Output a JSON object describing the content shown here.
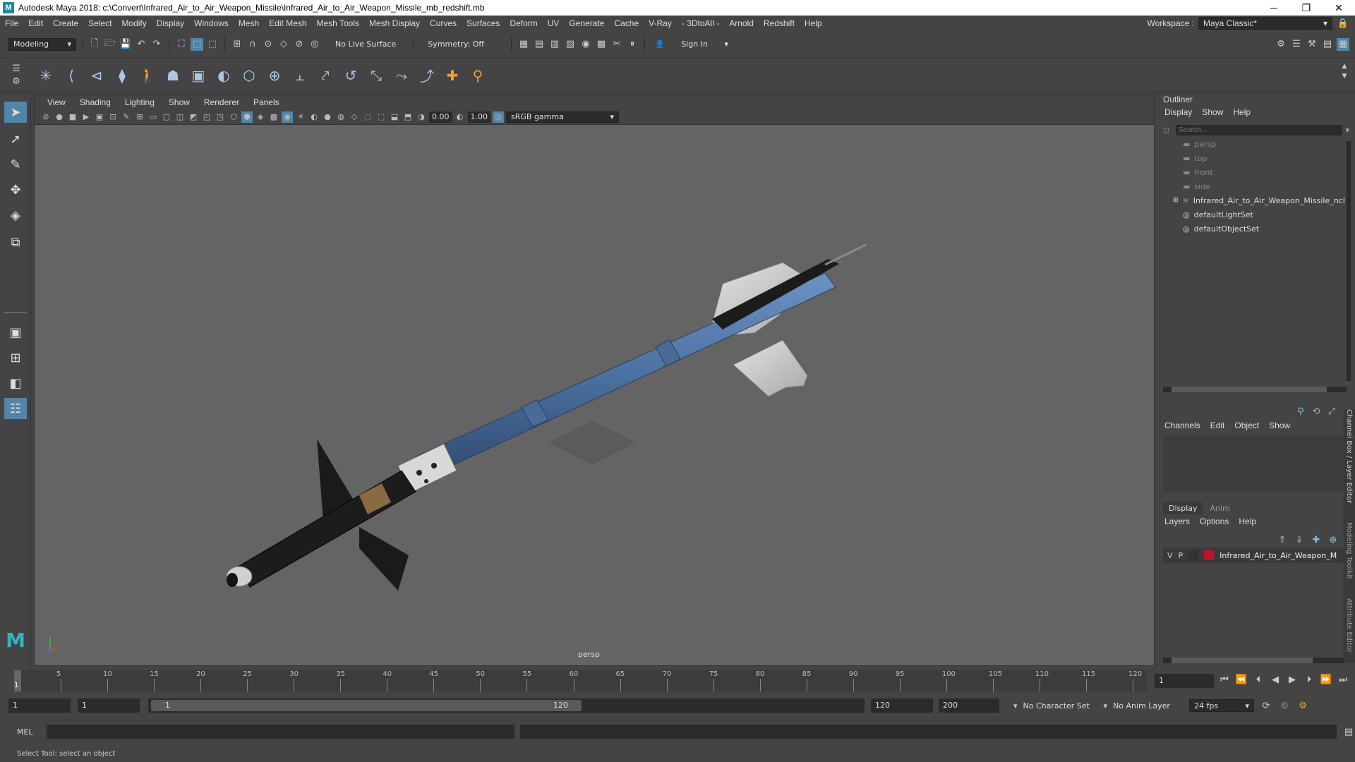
{
  "window": {
    "title": "Autodesk Maya 2018: c:\\Convert\\Infrared_Air_to_Air_Weapon_Missile\\Infrared_Air_to_Air_Weapon_Missile_mb_redshift.mb",
    "logo": "M",
    "minimize_icon": "minimize-icon",
    "maximize_icon": "maximize-icon",
    "close_icon": "close-icon"
  },
  "menubar": {
    "items": [
      "File",
      "Edit",
      "Create",
      "Select",
      "Modify",
      "Display",
      "Windows",
      "Mesh",
      "Edit Mesh",
      "Mesh Tools",
      "Mesh Display",
      "Curves",
      "Surfaces",
      "Deform",
      "UV",
      "Generate",
      "Cache",
      "V-Ray",
      "- 3DtoAll -",
      "Arnold",
      "Redshift",
      "Help"
    ],
    "workspace_label": "Workspace :",
    "workspace_value": "Maya Classic*"
  },
  "statusline": {
    "mode": "Modeling",
    "live_surface": "No Live Surface",
    "symmetry": "Symmetry: Off",
    "sign_in": "Sign In"
  },
  "viewport": {
    "menu": [
      "View",
      "Shading",
      "Lighting",
      "Show",
      "Renderer",
      "Panels"
    ],
    "exposure": "0.00",
    "gamma": "1.00",
    "color_space": "sRGB gamma",
    "camera_label": "persp"
  },
  "outliner": {
    "title": "Outliner",
    "menu": [
      "Display",
      "Show",
      "Help"
    ],
    "search_placeholder": "Search...",
    "items": [
      {
        "label": "persp",
        "icon": "camera-icon"
      },
      {
        "label": "top",
        "icon": "camera-icon"
      },
      {
        "label": "front",
        "icon": "camera-icon"
      },
      {
        "label": "side",
        "icon": "camera-icon"
      },
      {
        "label": "Infrared_Air_to_Air_Weapon_Missile_ncl",
        "icon": "group-icon"
      },
      {
        "label": "defaultLightSet",
        "icon": "set-icon"
      },
      {
        "label": "defaultObjectSet",
        "icon": "set-icon"
      }
    ]
  },
  "channelbox": {
    "menu": [
      "Channels",
      "Edit",
      "Object",
      "Show"
    ]
  },
  "layereditor": {
    "tabs": [
      "Display",
      "Anim"
    ],
    "menu": [
      "Layers",
      "Options",
      "Help"
    ],
    "layer": {
      "v": "V",
      "p": "P",
      "name": "Infrared_Air_to_Air_Weapon_M",
      "color": "#c0102a"
    }
  },
  "side_tabs": [
    "Channel Box / Layer Editor",
    "Modeling Toolkit",
    "Attribute Editor"
  ],
  "timeline": {
    "ticks": [
      "5",
      "10",
      "15",
      "20",
      "25",
      "30",
      "35",
      "40",
      "45",
      "50",
      "55",
      "60",
      "65",
      "70",
      "75",
      "80",
      "85",
      "90",
      "95",
      "100",
      "105",
      "110",
      "115",
      "120"
    ],
    "current_start": "1",
    "current_frame": "1"
  },
  "range": {
    "start": "1",
    "start2": "1",
    "slider_start": "1",
    "slider_end": "120",
    "end": "120",
    "end2": "200",
    "character_set": "No Character Set",
    "anim_layer": "No Anim Layer",
    "fps": "24 fps"
  },
  "cmdline": {
    "label": "MEL"
  },
  "helpline": {
    "text": "Select Tool: select an object"
  }
}
